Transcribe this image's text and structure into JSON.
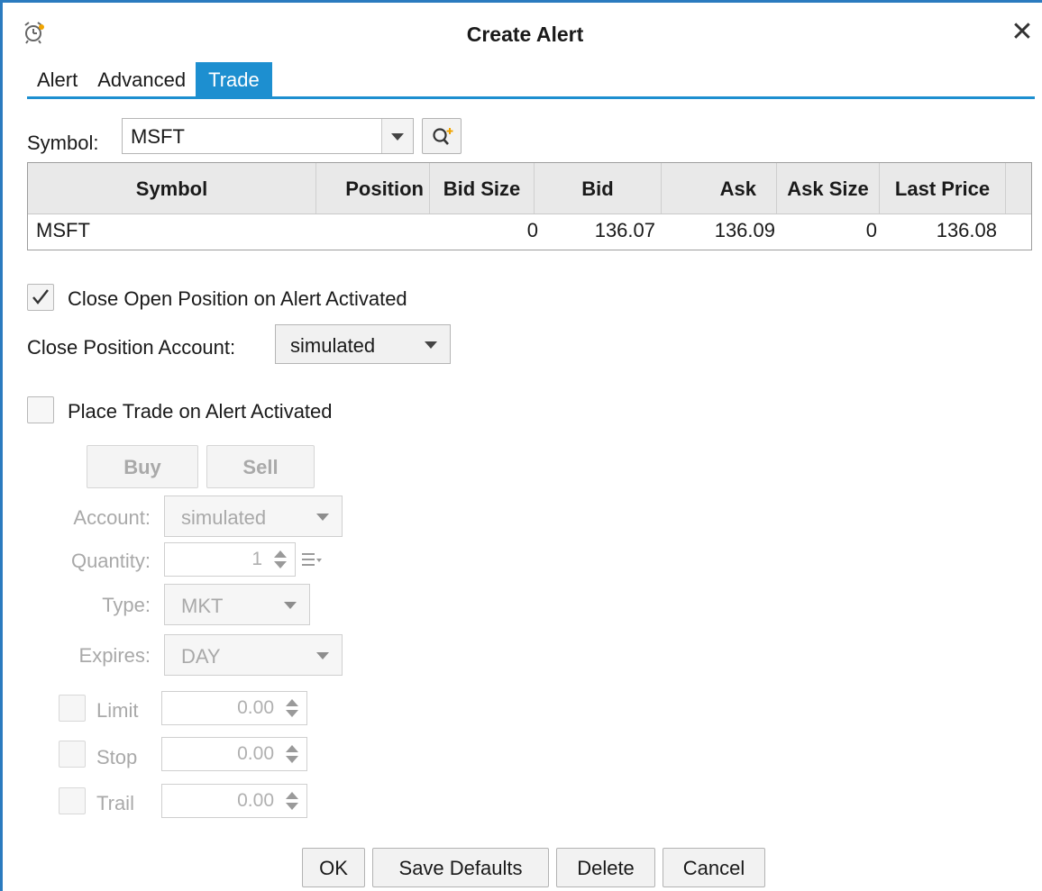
{
  "window": {
    "title": "Create Alert"
  },
  "tabs": [
    {
      "label": "Alert"
    },
    {
      "label": "Advanced"
    },
    {
      "label": "Trade"
    }
  ],
  "symbol": {
    "label": "Symbol:",
    "value": "MSFT"
  },
  "table": {
    "columns": [
      "Symbol",
      "Position",
      "Bid Size",
      "Bid",
      "Ask",
      "Ask Size",
      "Last Price"
    ],
    "rows": [
      {
        "symbol": "MSFT",
        "position": "",
        "bid_size": "0",
        "bid": "136.07",
        "ask": "136.09",
        "ask_size": "0",
        "last_price": "136.08"
      }
    ]
  },
  "close_position": {
    "checkbox_label": "Close Open Position on Alert Activated",
    "checked": true,
    "account_label": "Close Position Account:",
    "account_value": "simulated"
  },
  "place_trade": {
    "checkbox_label": "Place Trade on Alert Activated",
    "checked": false,
    "buy_label": "Buy",
    "sell_label": "Sell",
    "account_label": "Account:",
    "account_value": "simulated",
    "quantity_label": "Quantity:",
    "quantity_value": "1",
    "type_label": "Type:",
    "type_value": "MKT",
    "expires_label": "Expires:",
    "expires_value": "DAY",
    "limit_label": "Limit",
    "limit_value": "0.00",
    "stop_label": "Stop",
    "stop_value": "0.00",
    "trail_label": "Trail",
    "trail_value": "0.00"
  },
  "footer": {
    "ok_label": "OK",
    "save_defaults_label": "Save Defaults",
    "delete_label": "Delete",
    "cancel_label": "Cancel"
  },
  "colors": {
    "accent": "#1d8fd0",
    "window_border": "#2b7bbf",
    "disabled_text": "#a9a9a9"
  }
}
